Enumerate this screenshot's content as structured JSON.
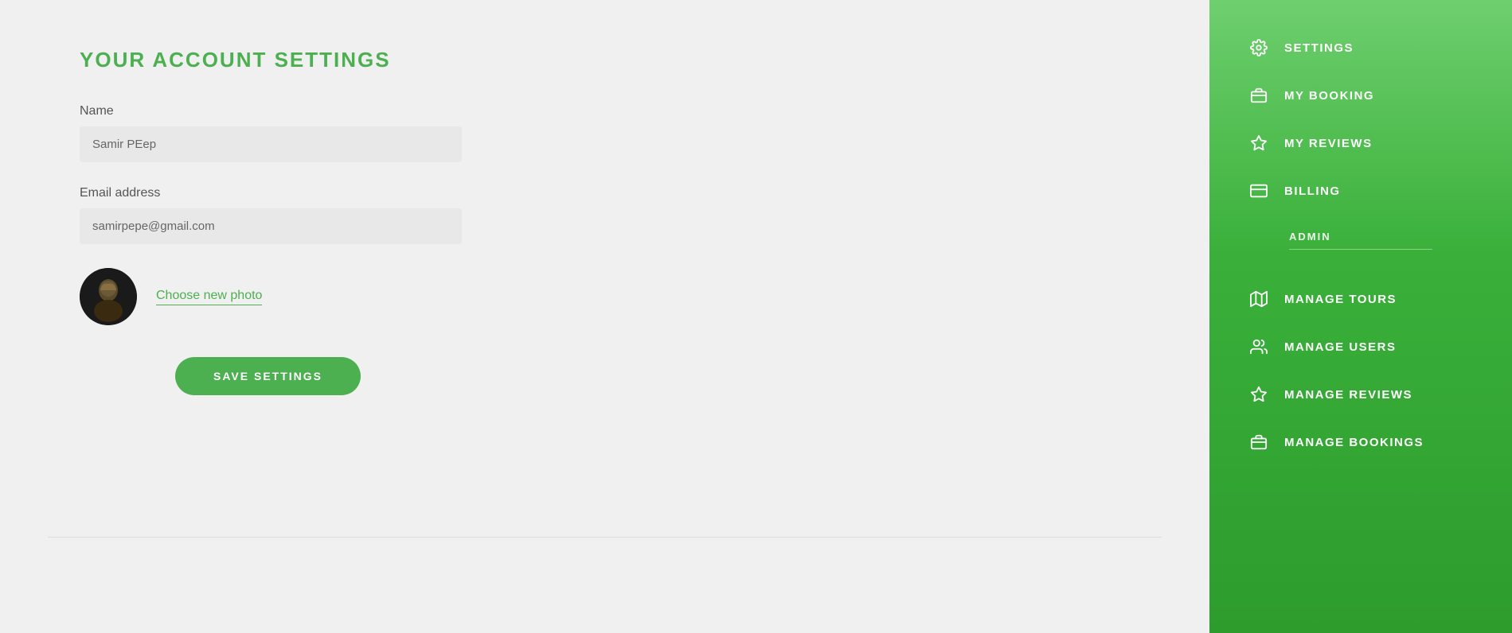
{
  "page": {
    "title": "YOUR ACCOUNT SETTINGS"
  },
  "form": {
    "name_label": "Name",
    "name_value": "Samir PEep",
    "email_label": "Email address",
    "email_value": "samirpepe@gmail.com",
    "choose_photo": "Choose new photo",
    "save_button": "SAVE SETTINGS"
  },
  "sidebar": {
    "admin_label": "ADMIN",
    "items": [
      {
        "id": "settings",
        "label": "SETTINGS",
        "icon": "gear"
      },
      {
        "id": "my-booking",
        "label": "MY BOOKING",
        "icon": "briefcase"
      },
      {
        "id": "my-reviews",
        "label": "MY REVIEWS",
        "icon": "star"
      },
      {
        "id": "billing",
        "label": "BILLING",
        "icon": "credit-card"
      },
      {
        "id": "manage-tours",
        "label": "MANAGE TOURS",
        "icon": "map"
      },
      {
        "id": "manage-users",
        "label": "MANAGE USERS",
        "icon": "users"
      },
      {
        "id": "manage-reviews",
        "label": "MANAGE REVIEWS",
        "icon": "star"
      },
      {
        "id": "manage-bookings",
        "label": "MANAGE BOOKINGS",
        "icon": "briefcase"
      }
    ]
  }
}
